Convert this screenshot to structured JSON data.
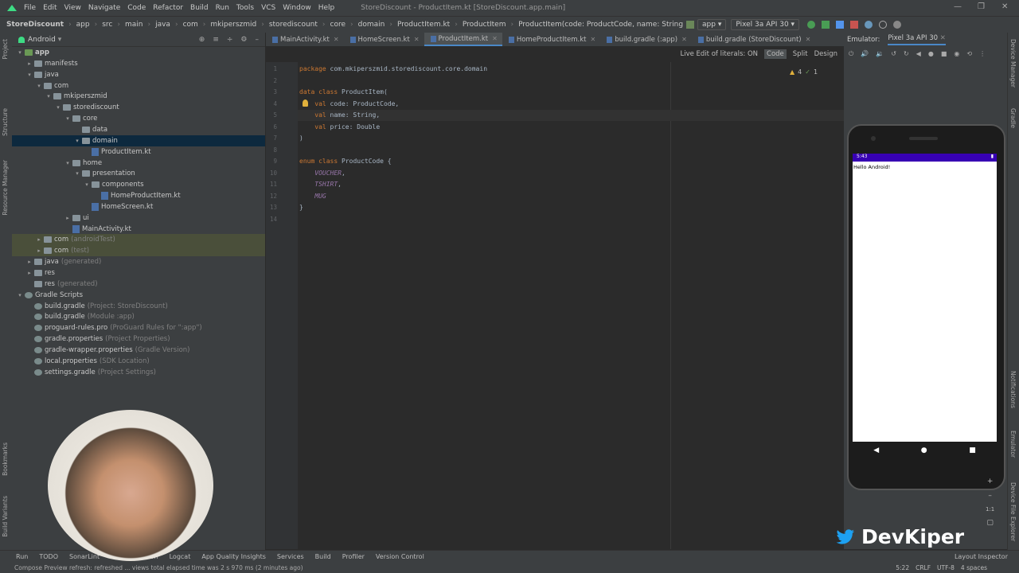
{
  "menu": {
    "items": [
      "File",
      "Edit",
      "View",
      "Navigate",
      "Code",
      "Refactor",
      "Build",
      "Run",
      "Tools",
      "VCS",
      "Window",
      "Help"
    ],
    "window_title": "StoreDiscount - ProductItem.kt [StoreDiscount.app.main]"
  },
  "breadcrumbs": [
    "StoreDiscount",
    "app",
    "src",
    "main",
    "java",
    "com",
    "mkiperszmid",
    "storediscount",
    "core",
    "domain",
    "ProductItem.kt",
    "ProductItem",
    "ProductItem(code: ProductCode, name: String, pr..."
  ],
  "toolbar": {
    "run_config": "app",
    "device": "Pixel 3a API 30"
  },
  "project": {
    "view_mode": "Android",
    "tree": [
      {
        "d": 0,
        "label": "app",
        "icon": "folder-app",
        "arrow": "▾",
        "bold": true
      },
      {
        "d": 1,
        "label": "manifests",
        "icon": "folder",
        "arrow": "▸"
      },
      {
        "d": 1,
        "label": "java",
        "icon": "folder",
        "arrow": "▾"
      },
      {
        "d": 2,
        "label": "com",
        "icon": "folder",
        "arrow": "▾"
      },
      {
        "d": 3,
        "label": "mkiperszmid",
        "icon": "folder",
        "arrow": "▾"
      },
      {
        "d": 4,
        "label": "storediscount",
        "icon": "folder",
        "arrow": "▾"
      },
      {
        "d": 5,
        "label": "core",
        "icon": "folder",
        "arrow": "▾"
      },
      {
        "d": 6,
        "label": "data",
        "icon": "folder",
        "arrow": ""
      },
      {
        "d": 6,
        "label": "domain",
        "icon": "folder",
        "arrow": "▾",
        "selected": true
      },
      {
        "d": 7,
        "label": "ProductItem.kt",
        "icon": "kotlin-file",
        "arrow": ""
      },
      {
        "d": 5,
        "label": "home",
        "icon": "folder",
        "arrow": "▾"
      },
      {
        "d": 6,
        "label": "presentation",
        "icon": "folder",
        "arrow": "▾"
      },
      {
        "d": 7,
        "label": "components",
        "icon": "folder",
        "arrow": "▾"
      },
      {
        "d": 8,
        "label": "HomeProductItem.kt",
        "icon": "kotlin-file",
        "arrow": ""
      },
      {
        "d": 7,
        "label": "HomeScreen.kt",
        "icon": "kotlin-file",
        "arrow": ""
      },
      {
        "d": 5,
        "label": "ui",
        "icon": "folder",
        "arrow": "▸"
      },
      {
        "d": 5,
        "label": "MainActivity.kt",
        "icon": "kotlin-file",
        "arrow": ""
      },
      {
        "d": 2,
        "label": "com",
        "sub": "(androidTest)",
        "icon": "folder",
        "arrow": "▸",
        "hl": true
      },
      {
        "d": 2,
        "label": "com",
        "sub": "(test)",
        "icon": "folder",
        "arrow": "▸",
        "hl": true
      },
      {
        "d": 1,
        "label": "java",
        "sub": "(generated)",
        "icon": "folder",
        "arrow": "▸"
      },
      {
        "d": 1,
        "label": "res",
        "icon": "folder",
        "arrow": "▸"
      },
      {
        "d": 1,
        "label": "res",
        "sub": "(generated)",
        "icon": "folder",
        "arrow": ""
      },
      {
        "d": 0,
        "label": "Gradle Scripts",
        "icon": "gradle",
        "arrow": "▾"
      },
      {
        "d": 1,
        "label": "build.gradle",
        "sub": "(Project: StoreDiscount)",
        "icon": "gradle",
        "arrow": ""
      },
      {
        "d": 1,
        "label": "build.gradle",
        "sub": "(Module :app)",
        "icon": "gradle",
        "arrow": ""
      },
      {
        "d": 1,
        "label": "proguard-rules.pro",
        "sub": "(ProGuard Rules for \":app\")",
        "icon": "gradle",
        "arrow": ""
      },
      {
        "d": 1,
        "label": "gradle.properties",
        "sub": "(Project Properties)",
        "icon": "gradle",
        "arrow": ""
      },
      {
        "d": 1,
        "label": "gradle-wrapper.properties",
        "sub": "(Gradle Version)",
        "icon": "gradle",
        "arrow": ""
      },
      {
        "d": 1,
        "label": "local.properties",
        "sub": "(SDK Location)",
        "icon": "gradle",
        "arrow": ""
      },
      {
        "d": 1,
        "label": "settings.gradle",
        "sub": "(Project Settings)",
        "icon": "gradle",
        "arrow": ""
      }
    ]
  },
  "editor": {
    "tabs": [
      {
        "label": "MainActivity.kt",
        "active": false
      },
      {
        "label": "HomeScreen.kt",
        "active": false
      },
      {
        "label": "ProductItem.kt",
        "active": true
      },
      {
        "label": "HomeProductItem.kt",
        "active": false
      },
      {
        "label": "build.gradle (:app)",
        "active": false
      },
      {
        "label": "build.gradle (StoreDiscount)",
        "active": false
      }
    ],
    "toolbar": {
      "live_edit": "Live Edit of literals: ON",
      "code": "Code",
      "split": "Split",
      "design": "Design",
      "warnings": "4",
      "checks": "1"
    },
    "lines": [
      "package com.mkiperszmid.storediscount.core.domain",
      "",
      "data class ProductItem(",
      "    val code: ProductCode,",
      "    val name: String,",
      "    val price: Double",
      ")",
      "",
      "enum class ProductCode {",
      "    VOUCHER,",
      "    TSHIRT,",
      "    MUG",
      "}",
      ""
    ]
  },
  "emulator": {
    "label": "Emulator:",
    "device_tab": "Pixel 3a API 30",
    "status_time": "5:43",
    "app_text": "Hello Android!",
    "zoom": "1:1"
  },
  "bottom_tools": [
    "Run",
    "TODO",
    "SonarLint",
    "App Inspection",
    "Logcat",
    "App Quality Insights",
    "Services",
    "Build",
    "Profiler",
    "Version Control"
  ],
  "layout_inspector": "Layout Inspector",
  "status": {
    "message": "Compose Preview refresh: refreshed ... views total elapsed time was 2 s 970 ms (2 minutes ago)",
    "position": "5:22",
    "line_sep": "CRLF",
    "encoding": "UTF-8",
    "indent": "4 spaces"
  },
  "left_stripe": [
    "Project",
    "Structure",
    "Resource Manager",
    "Bookmarks",
    "Build Variants"
  ],
  "right_stripe": [
    "Device Manager",
    "Gradle",
    "Notifications",
    "Emulator",
    "Device File Explorer"
  ],
  "watermark": "DevKiper"
}
